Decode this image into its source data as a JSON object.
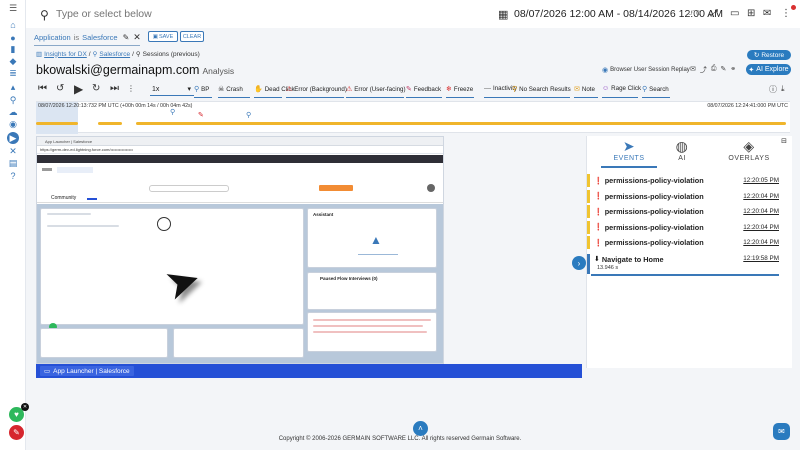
{
  "topbar": {
    "search_placeholder": "Type or select below",
    "date_range": "08/07/2026 12:00 AM - 08/14/2026 12:00 AM",
    "timezone": "UTC"
  },
  "filter": {
    "field": "Application",
    "operator": "is",
    "value": "Salesforce",
    "save_label": "SAVE",
    "clear_label": "CLEAR"
  },
  "breadcrumb": {
    "item1": "Insights for DX",
    "sep1": "/",
    "item2": "Salesforce",
    "sep2": "/",
    "item3": "Sessions (previous)"
  },
  "restore_label": "Restore",
  "user": {
    "email": "bkowalski@germainapm.com",
    "subtitle": "Analysis"
  },
  "replay_mode_label": "Browser User Session Replay",
  "ai_explore_label": "AI Explore",
  "player": {
    "speed": "1x",
    "filters": [
      {
        "label": "BP",
        "icon": "⚲",
        "color": "#3a78b8"
      },
      {
        "label": "Crash",
        "icon": "☠",
        "color": "#111"
      },
      {
        "label": "Dead Click",
        "icon": "✋",
        "color": "#666"
      },
      {
        "label": "Error (Background)",
        "icon": "⚠",
        "color": "#d93030"
      },
      {
        "label": "Error (User-facing)",
        "icon": "⚠",
        "color": "#d93030"
      },
      {
        "label": "Feedback",
        "icon": "✎",
        "color": "#c0406a"
      },
      {
        "label": "Freeze",
        "icon": "❄",
        "color": "#d93030"
      },
      {
        "label": "Inactivity",
        "icon": "—",
        "color": "#666"
      },
      {
        "label": "No Search Results",
        "icon": "⚲",
        "color": "#e0a020"
      },
      {
        "label": "Note",
        "icon": "✉",
        "color": "#e0a020"
      },
      {
        "label": "Rage Click",
        "icon": "☺",
        "color": "#8a40c0"
      },
      {
        "label": "Search",
        "icon": "⚲",
        "color": "#3a78b8"
      }
    ]
  },
  "timeline": {
    "start_label": "08/07/2026 12:20:13:732 PM UTC (+00h 00m 14s / 00h 04m 42s)",
    "end_label": "08/07/2026 12:24:41:000 PM UTC"
  },
  "replay": {
    "tab_title": "App Launcher | Salesforce",
    "url": "https://germ-dev-ed.lightning.force.com/••••••••••••••••",
    "app_name": "Community",
    "assistant_title": "Assistant",
    "paused_title": "Paused Flow Interviews (0)",
    "launcher_label": "App Launcher | Salesforce"
  },
  "events_panel": {
    "tabs": [
      {
        "label": "EVENTS",
        "icon": "➤"
      },
      {
        "label": "AI",
        "icon": "◍"
      },
      {
        "label": "OVERLAYS",
        "icon": "◈"
      }
    ],
    "rows": [
      {
        "name": "permissions-policy-violation",
        "time": "12:20:05 PM"
      },
      {
        "name": "permissions-policy-violation",
        "time": "12:20:04 PM"
      },
      {
        "name": "permissions-policy-violation",
        "time": "12:20:04 PM"
      },
      {
        "name": "permissions-policy-violation",
        "time": "12:20:04 PM"
      },
      {
        "name": "permissions-policy-violation",
        "time": "12:20:04 PM"
      }
    ],
    "navigate": {
      "name": "Navigate to Home",
      "time": "12:19:58 PM",
      "duration": "13.946 s"
    }
  },
  "footer": "Copyright © 2006-2026 GERMAIN SOFTWARE LLC. All rights reserved Germain Software.",
  "colors": {
    "accent": "#2a7bbf",
    "timeline": "#f0b52b",
    "warning": "#f0c430",
    "launcher": "#2550d6"
  }
}
